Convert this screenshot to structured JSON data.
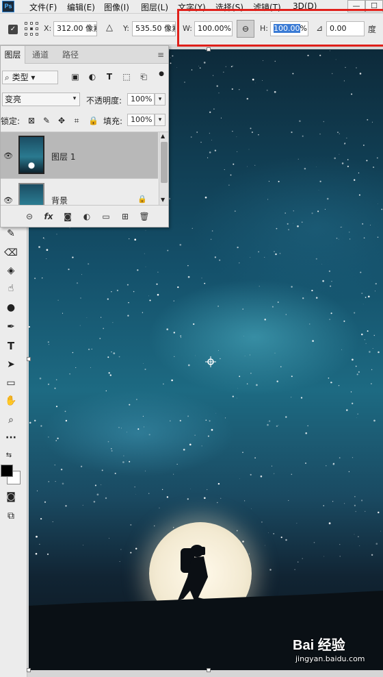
{
  "app": {
    "logo": "Ps"
  },
  "menubar": {
    "items": [
      "文件(F)",
      "编辑(E)",
      "图像(I)",
      "图层(L)",
      "文字(Y)",
      "选择(S)",
      "滤镜(T)",
      "3D(D)"
    ],
    "window_buttons": [
      "—",
      "☐"
    ]
  },
  "options": {
    "x_label": "X:",
    "x_value": "312.00 像素",
    "y_label": "Y:",
    "y_value": "535.50 像素",
    "w_label": "W:",
    "w_value": "100.00%",
    "h_label": "H:",
    "h_value_selected": "100.00",
    "h_value_unit": "%",
    "angle_value": "0.00",
    "angle_unit": "度",
    "highlight_color": "#e0201a"
  },
  "layers_panel": {
    "tabs": [
      "图层",
      "通道",
      "路径"
    ],
    "filter_type": "类型",
    "blend_mode": "变亮",
    "opacity_label": "不透明度:",
    "opacity_value": "100%",
    "lock_label": "锁定:",
    "fill_label": "填充:",
    "fill_value": "100%",
    "layers": [
      {
        "name": "图层 1",
        "selected": true
      },
      {
        "name": "背景",
        "selected": false
      }
    ],
    "footer_icons": [
      "link-icon",
      "fx-icon",
      "mask-icon",
      "adjustment-icon",
      "group-folder-icon",
      "new-layer-icon",
      "trash-icon"
    ],
    "fx_label": "fx"
  },
  "toolbar": {
    "tools": [
      "brush-icon",
      "eraser-icon",
      "paint-bucket-icon",
      "smudge-icon",
      "dodge-icon",
      "pen-icon",
      "type-icon",
      "path-select-icon",
      "rectangle-icon",
      "hand-icon",
      "zoom-icon",
      "more-icon"
    ],
    "type_glyph": "T",
    "more_glyph": "···"
  },
  "watermark": {
    "logo": "Bai 经验",
    "url": "jingyan.baidu.com"
  }
}
